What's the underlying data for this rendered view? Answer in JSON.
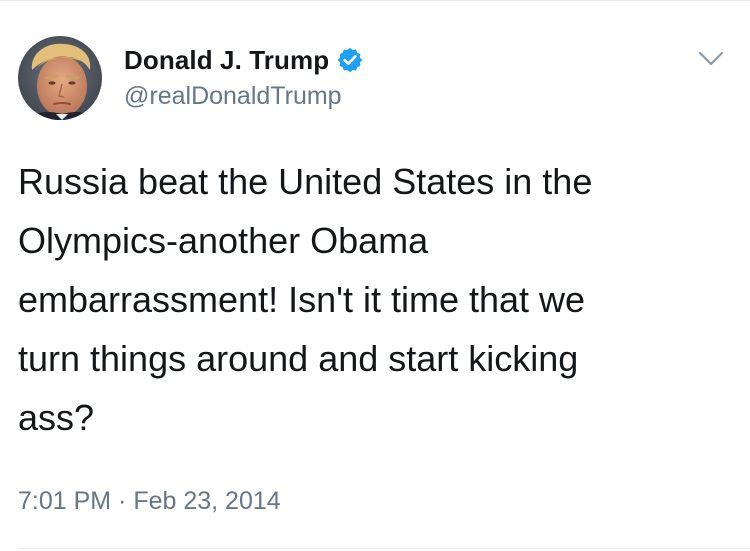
{
  "tweet": {
    "author": {
      "display_name": "Donald J. Trump",
      "handle": "@realDonaldTrump",
      "verified": true,
      "verified_icon": "verified-badge-icon",
      "avatar_icon": "profile-photo"
    },
    "menu_icon": "chevron-down-icon",
    "text": "Russia beat the United States in the\nOlympics-another Obama\nembarrassment! Isn't it time that we\nturn things around and start kicking\nass?",
    "timestamp": "7:01 PM · Feb 23, 2014"
  },
  "colors": {
    "text_primary": "#14171a",
    "text_secondary": "#657786",
    "verified_blue": "#1da1f2",
    "divider": "#e6ecf0"
  }
}
